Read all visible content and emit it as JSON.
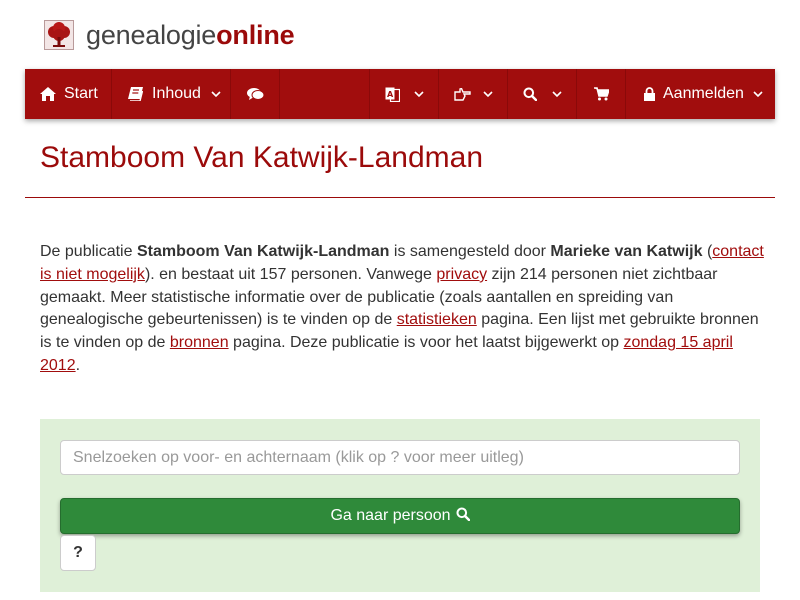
{
  "logo": {
    "part1": "genealogie",
    "part2": "online",
    "icon": "tree-icon"
  },
  "nav": {
    "start": "Start",
    "inhoud": "Inhoud",
    "login": "Aanmelden",
    "icons": [
      "home-icon",
      "book-icon",
      "comments-icon",
      "language-icon",
      "hand-pointer-icon",
      "search-icon",
      "shopping-cart-icon",
      "lock-icon"
    ]
  },
  "page": {
    "title": "Stamboom Van Katwijk-Landman"
  },
  "intro": {
    "t1": "De publicatie ",
    "pub": "Stamboom Van Katwijk-Landman",
    "t2": " is samengesteld door ",
    "author": "Marieke van Katwijk",
    "t3": " (",
    "contact": "contact is niet mogelijk",
    "t4": "). en bestaat uit 157 personen. Vanwege ",
    "privacy": "privacy",
    "t5": " zijn 214 personen niet zichtbaar gemaakt. Meer statistische informatie over de publicatie (zoals aantallen en spreiding van genealogische gebeurtenissen) is te vinden op de ",
    "stats": "statistieken",
    "t6": " pagina. Een lijst met gebruikte bronnen is te vinden op de ",
    "sources": "bronnen",
    "t7": " pagina. Deze publicatie is voor het laatst bijgewerkt op ",
    "date": "zondag 15 april 2012",
    "t8": "."
  },
  "search": {
    "placeholder": "Snelzoeken op voor- en achternaam (klik op ? voor meer uitleg)",
    "button": "Ga naar persoon",
    "help": "?"
  },
  "colors": {
    "brand": "#a10d0d",
    "panel": "#dff0d8",
    "button": "#2f8a3a"
  }
}
